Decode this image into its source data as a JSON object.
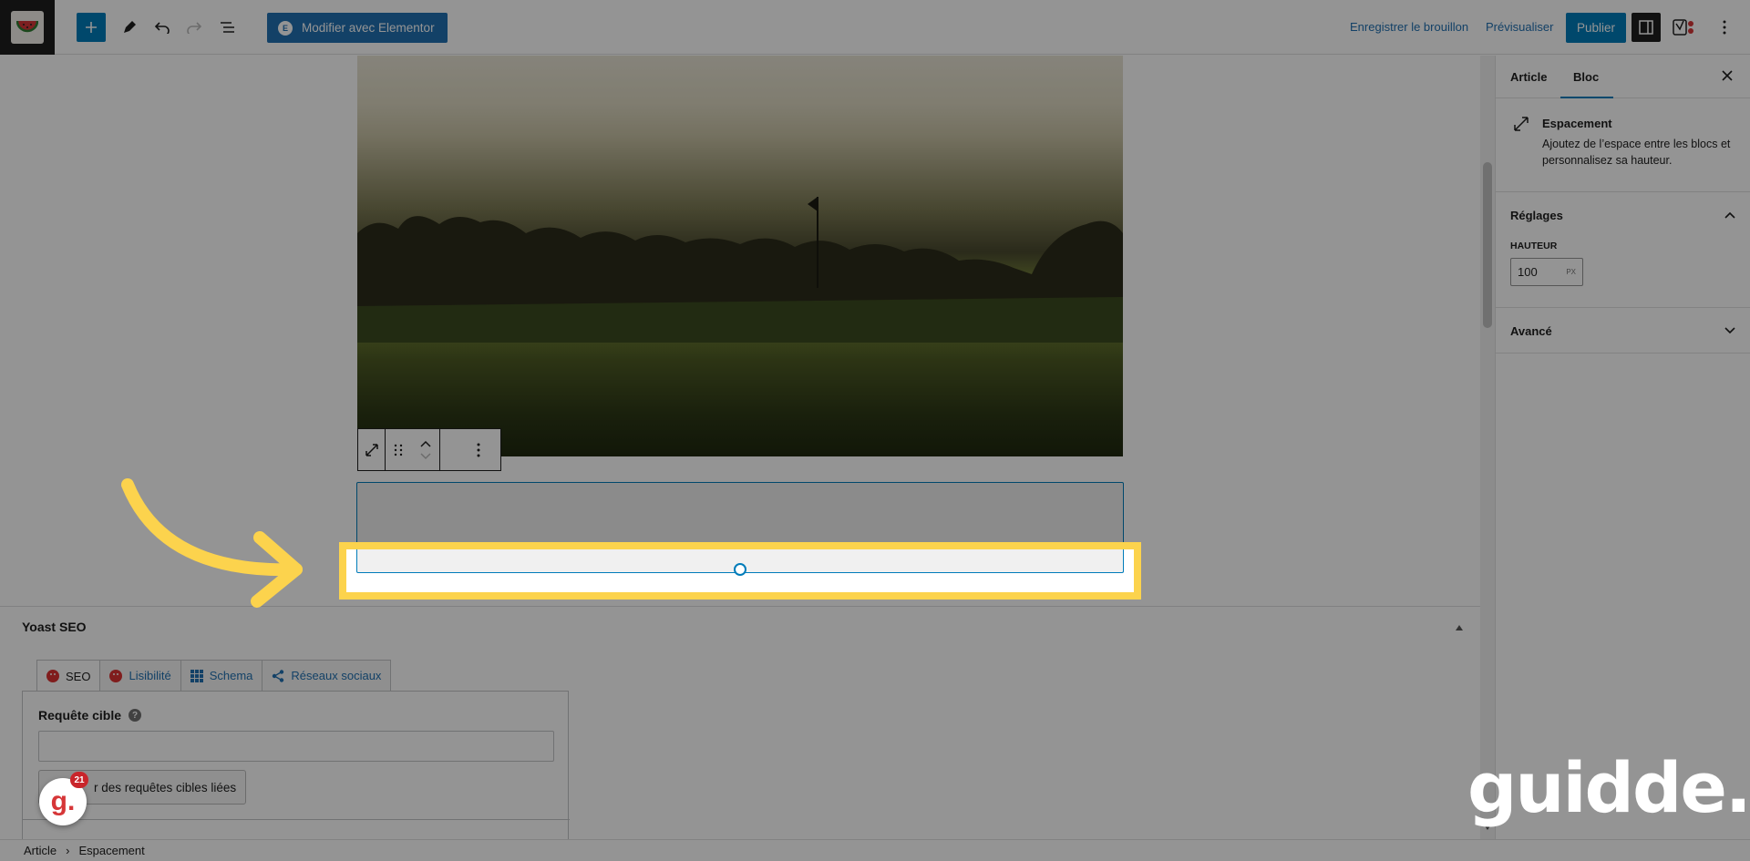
{
  "toolbar": {
    "elementor_label": "Modifier avec Elementor",
    "save_draft_label": "Enregistrer le brouillon",
    "preview_label": "Prévisualiser",
    "publish_label": "Publier"
  },
  "block_toolbar": {
    "icons": [
      "spacer-icon",
      "drag-handle-icon",
      "move-up-icon",
      "move-down-icon",
      "more-options-icon"
    ]
  },
  "yoast": {
    "title": "Yoast SEO",
    "tabs": [
      {
        "label": "SEO",
        "icon": "sad-face-icon"
      },
      {
        "label": "Lisibilité",
        "icon": "sad-face-icon"
      },
      {
        "label": "Schema",
        "icon": "grid-icon"
      },
      {
        "label": "Réseaux sociaux",
        "icon": "share-icon"
      }
    ],
    "keyphrase_label": "Requête cible",
    "keyphrase_value": "",
    "related_button": "Ajouter des requêtes cibles liées",
    "related_button_visible": "r des requêtes cibles liées"
  },
  "sidebar": {
    "tab_article": "Article",
    "tab_block": "Bloc",
    "block_title": "Espacement",
    "block_desc": "Ajoutez de l’espace entre les blocs et personnalisez sa hauteur.",
    "settings_title": "Réglages",
    "height_label": "HAUTEUR",
    "height_value": "100",
    "height_unit": "PX",
    "advanced_title": "Avancé"
  },
  "breadcrumb": {
    "items": [
      "Article",
      "Espacement"
    ],
    "separator": "›"
  },
  "overlay": {
    "brand_text": "guidde.",
    "avatar_letter": "g.",
    "badge_count": "21"
  },
  "colors": {
    "accent": "#007cba",
    "highlight": "#fcd34d",
    "yoast_error": "#dc3232"
  }
}
